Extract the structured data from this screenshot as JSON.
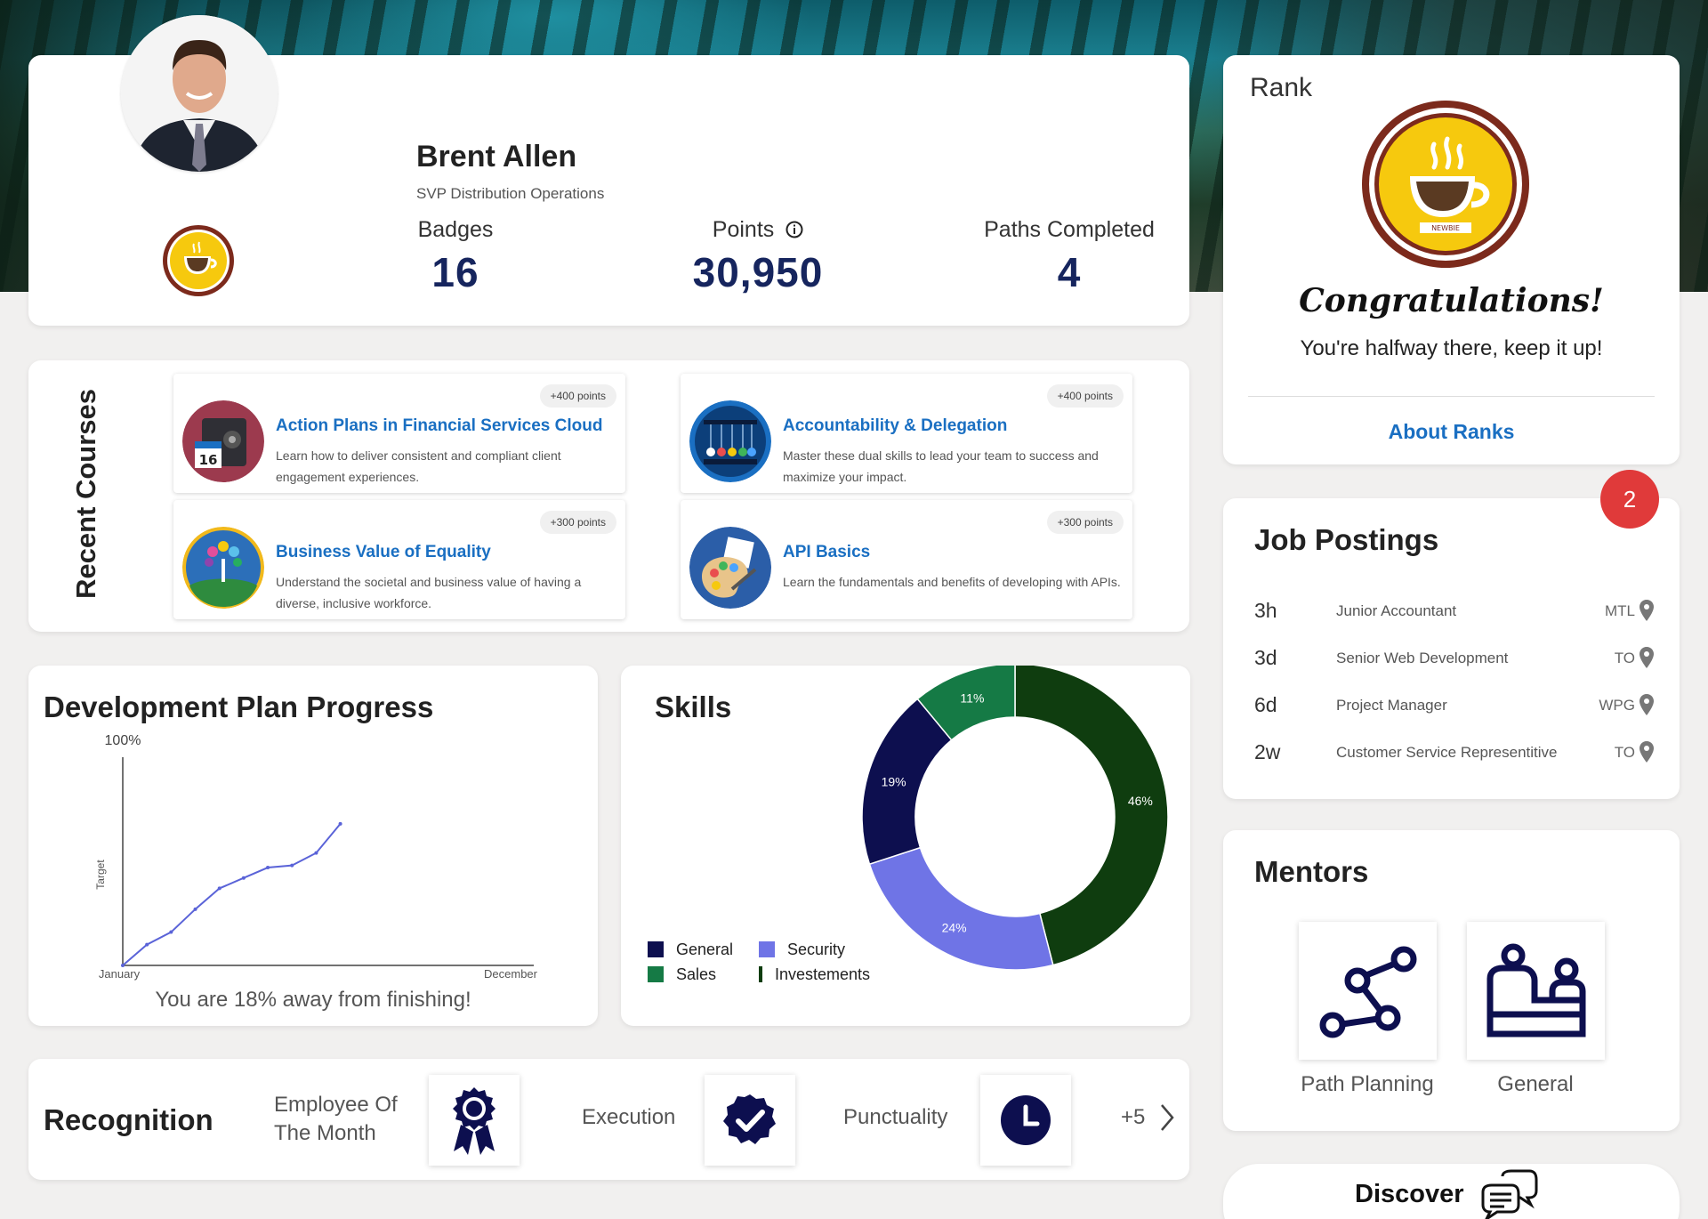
{
  "profile": {
    "name": "Brent Allen",
    "title": "SVP Distribution Operations",
    "stats": [
      {
        "label": "Badges",
        "value": "16"
      },
      {
        "label": "Points",
        "value": "30,950"
      },
      {
        "label": "Paths Completed",
        "value": "4"
      }
    ]
  },
  "rank": {
    "header": "Rank",
    "badge_text": "NEWBIE",
    "congrats": "Congratulations!",
    "message": "You're halfway there, keep it up!",
    "link": "About Ranks"
  },
  "courses": {
    "header": "Recent Courses",
    "items": [
      {
        "title": "Action Plans in Financial Services Cloud",
        "desc": "Learn how to deliver consistent and compliant client engagement experiences.",
        "points": "+400 points",
        "icon": "safe-calendar-icon",
        "icon_date": "16"
      },
      {
        "title": "Accountability & Delegation",
        "desc": "Master these dual skills to lead your team to success and maximize your impact.",
        "points": "+400 points",
        "icon": "newtons-cradle-icon"
      },
      {
        "title": "Business Value of Equality",
        "desc": "Understand the societal and business value of having a diverse, inclusive workforce.",
        "points": "+300 points",
        "icon": "globe-tree-icon"
      },
      {
        "title": "API Basics",
        "desc": "Learn the fundamentals and benefits of developing with APIs.",
        "points": "+300 points",
        "icon": "paint-palette-icon"
      }
    ]
  },
  "devplan": {
    "header": "Development Plan Progress",
    "footer": "You are 18% away from finishing!"
  },
  "skills": {
    "header": "Skills",
    "legend": [
      {
        "name": "General",
        "color": "#0d0f4f"
      },
      {
        "name": "Security",
        "color": "#6f74e6"
      },
      {
        "name": "Sales",
        "color": "#157a45"
      },
      {
        "name": "Investements",
        "color": "#0f3d0f"
      }
    ]
  },
  "chart_data": [
    {
      "type": "line",
      "title": "Development Plan Progress",
      "ylabel": "Target",
      "ytick_top": "100%",
      "xtick_start": "January",
      "xtick_end": "December",
      "x": [
        0,
        1,
        2,
        3,
        4,
        5,
        6,
        7,
        8,
        9
      ],
      "values": [
        0,
        10,
        16,
        27,
        37,
        42,
        47,
        48,
        54,
        68
      ],
      "ylim": [
        0,
        100
      ],
      "xlim": [
        0,
        17
      ],
      "color": "#5a63d8"
    },
    {
      "type": "pie",
      "title": "Skills",
      "donut": true,
      "slices": [
        {
          "name": "Investements",
          "value": 46,
          "label": "46%",
          "color": "#0f3d0f"
        },
        {
          "name": "Security",
          "value": 24,
          "label": "24%",
          "color": "#6f74e6"
        },
        {
          "name": "General",
          "value": 19,
          "label": "19%",
          "color": "#0d0f4f"
        },
        {
          "name": "Sales",
          "value": 11,
          "label": "11%",
          "color": "#157a45"
        }
      ]
    }
  ],
  "jobs": {
    "header": "Job Postings",
    "count": "2",
    "items": [
      {
        "age": "3h",
        "role": "Junior Accountant",
        "loc": "MTL"
      },
      {
        "age": "3d",
        "role": "Senior Web Development",
        "loc": "TO"
      },
      {
        "age": "6d",
        "role": "Project Manager",
        "loc": "WPG"
      },
      {
        "age": "2w",
        "role": "Customer Service Representitive",
        "loc": "TO"
      }
    ]
  },
  "mentors": {
    "header": "Mentors",
    "items": [
      {
        "label": "Path Planning",
        "icon": "path-nodes-icon"
      },
      {
        "label": "General",
        "icon": "meeting-people-icon"
      }
    ]
  },
  "discover": {
    "label": "Discover",
    "icon": "chat-bubbles-icon"
  },
  "recognition": {
    "header": "Recognition",
    "items": [
      {
        "label": "Employee Of The Month",
        "icon": "award-ribbon-icon"
      },
      {
        "label": "Execution",
        "icon": "check-seal-icon"
      },
      {
        "label": "Punctuality",
        "icon": "clock-icon"
      }
    ],
    "more": "+5"
  },
  "colors": {
    "navy": "#16255e",
    "link": "#1a6fc2",
    "badge_red": "#e03a3a"
  }
}
